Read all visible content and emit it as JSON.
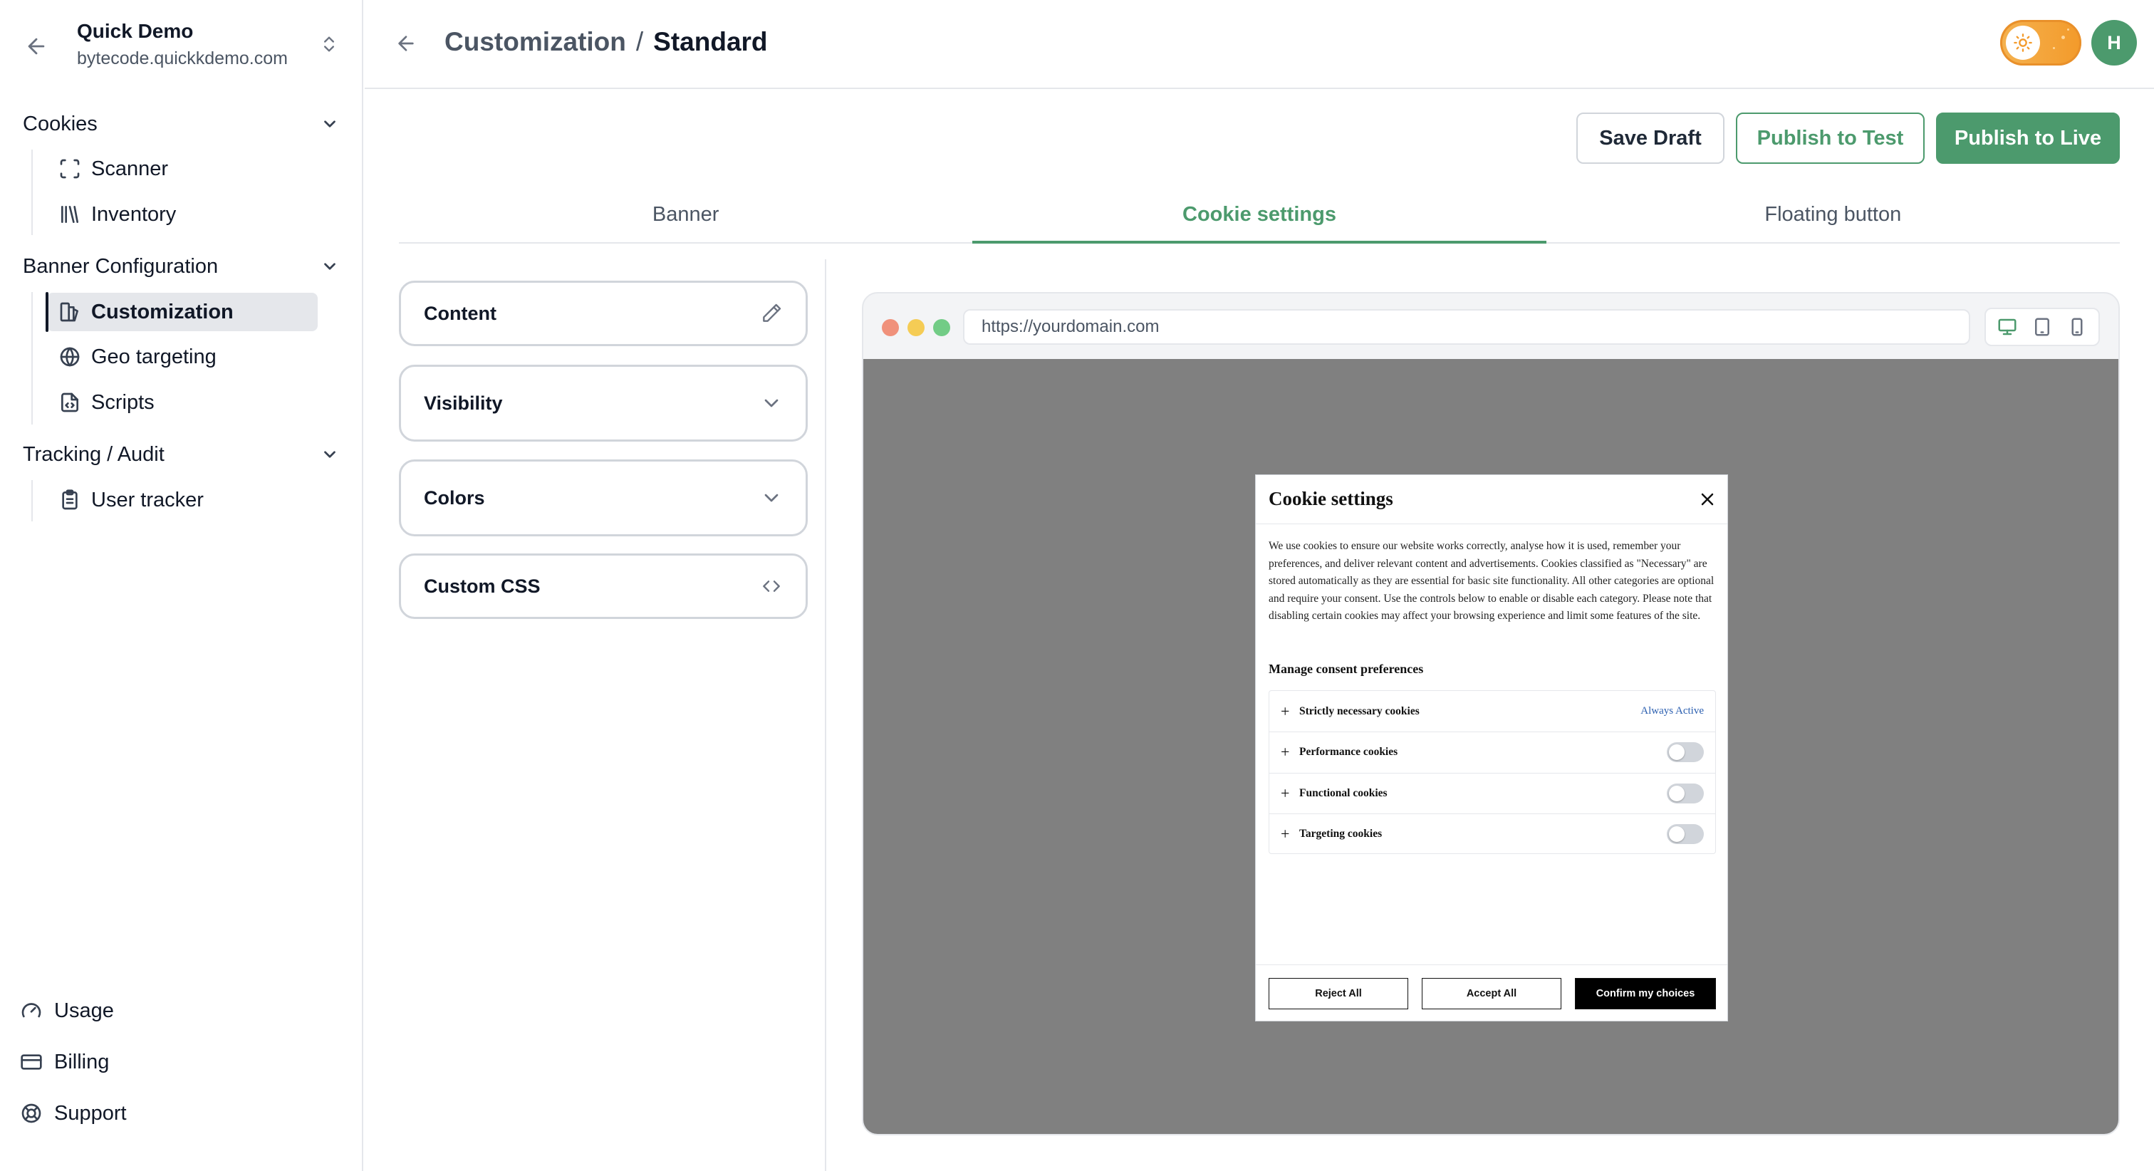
{
  "workspace": {
    "name": "Quick Demo",
    "domain": "bytecode.quickkdemo.com"
  },
  "sidebar": {
    "sections": [
      {
        "label": "Cookies",
        "items": [
          {
            "label": "Scanner",
            "icon": "scan-icon"
          },
          {
            "label": "Inventory",
            "icon": "library-icon"
          }
        ]
      },
      {
        "label": "Banner Configuration",
        "items": [
          {
            "label": "Customization",
            "icon": "palette-icon",
            "active": true
          },
          {
            "label": "Geo targeting",
            "icon": "globe-icon"
          },
          {
            "label": "Scripts",
            "icon": "file-code-icon"
          }
        ]
      },
      {
        "label": "Tracking / Audit",
        "items": [
          {
            "label": "User tracker",
            "icon": "clipboard-icon"
          }
        ]
      }
    ],
    "footer": [
      {
        "label": "Usage",
        "icon": "gauge-icon"
      },
      {
        "label": "Billing",
        "icon": "credit-card-icon"
      },
      {
        "label": "Support",
        "icon": "life-buoy-icon"
      }
    ]
  },
  "header": {
    "breadcrumb_parent": "Customization",
    "breadcrumb_separator": "/",
    "breadcrumb_current": "Standard",
    "avatar_initial": "H",
    "theme": "light"
  },
  "actions": {
    "save_draft": "Save Draft",
    "publish_test": "Publish to Test",
    "publish_live": "Publish to Live"
  },
  "tabs": [
    {
      "label": "Banner",
      "active": false
    },
    {
      "label": "Cookie settings",
      "active": true
    },
    {
      "label": "Floating button",
      "active": false
    }
  ],
  "settings": [
    {
      "label": "Content",
      "icon": "pencil-icon"
    },
    {
      "label": "Visibility",
      "icon": "chevron-down-icon"
    },
    {
      "label": "Colors",
      "icon": "chevron-down-icon"
    },
    {
      "label": "Custom CSS",
      "icon": "code-icon"
    }
  ],
  "preview": {
    "url": "https://yourdomain.com",
    "device": "desktop",
    "modal": {
      "title": "Cookie settings",
      "description": "We use cookies to ensure our website works correctly, analyse how it is used, remember your preferences, and deliver relevant content and advertisements. Cookies classified as \"Necessary\" are stored automatically as they are essential for basic site functionality. All other categories are optional and require your consent. Use the controls below to enable or disable each category. Please note that disabling certain cookies may affect your browsing experience and limit some features of the site.",
      "subtitle": "Manage consent preferences",
      "categories": [
        {
          "label": "Strictly necessary cookies",
          "status": "Always Active"
        },
        {
          "label": "Performance cookies",
          "enabled": false
        },
        {
          "label": "Functional cookies",
          "enabled": false
        },
        {
          "label": "Targeting cookies",
          "enabled": false
        }
      ],
      "buttons": {
        "reject": "Reject All",
        "accept": "Accept All",
        "confirm": "Confirm my choices"
      }
    }
  },
  "colors": {
    "accent": "#4c9a6d",
    "toggle_orange": "#f39a2a",
    "overlay": "#808080",
    "always_active": "#2b5fb0"
  }
}
